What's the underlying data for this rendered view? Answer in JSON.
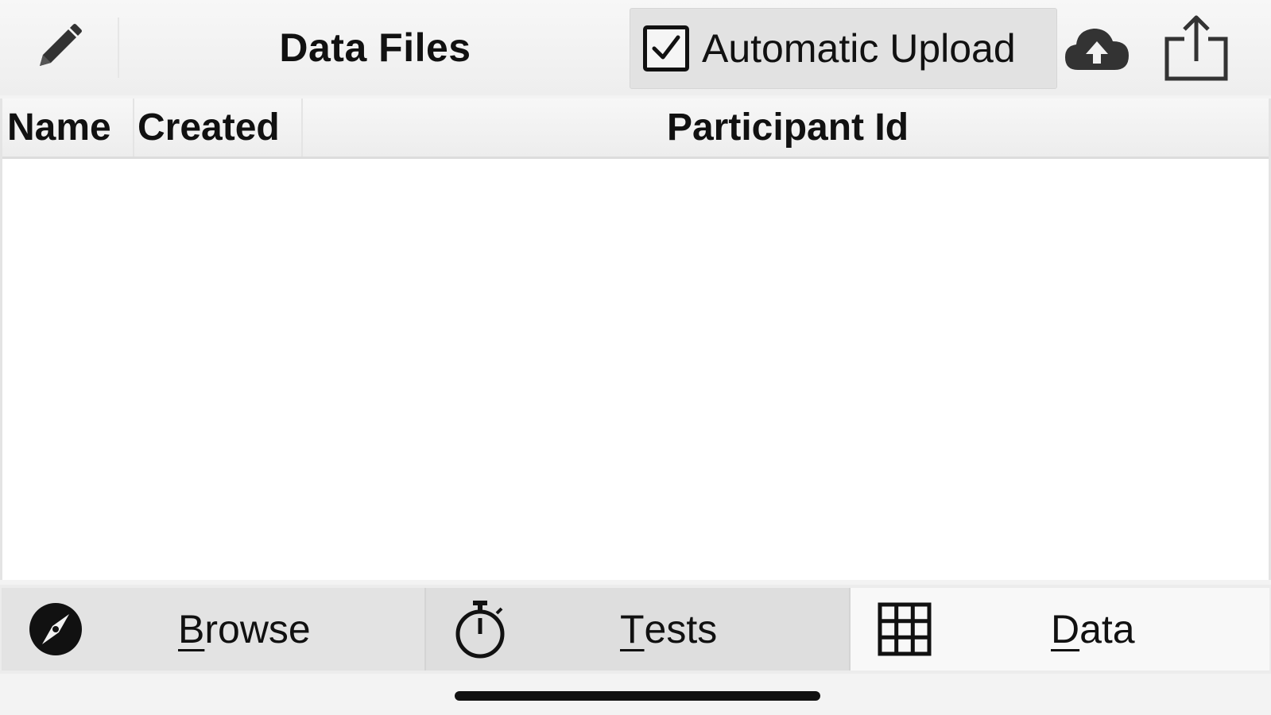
{
  "toolbar": {
    "title": "Data Files",
    "auto_upload_label": "Automatic Upload",
    "auto_upload_checked": true,
    "edit_icon": "pencil-icon",
    "upload_icon": "cloud-upload-icon",
    "share_icon": "share-icon"
  },
  "table": {
    "columns": [
      "Name",
      "Created",
      "Participant Id"
    ],
    "rows": []
  },
  "tabs": [
    {
      "label_first": "B",
      "label_rest": "rowse",
      "icon": "compass-icon",
      "selected": false
    },
    {
      "label_first": "T",
      "label_rest": "ests",
      "icon": "stopwatch-icon",
      "selected": false
    },
    {
      "label_first": "D",
      "label_rest": "ata",
      "icon": "grid-icon",
      "selected": true
    }
  ]
}
